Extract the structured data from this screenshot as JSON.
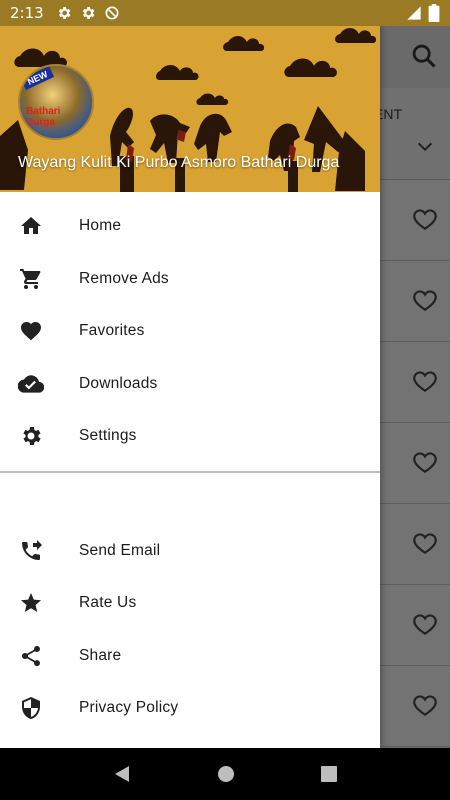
{
  "status_bar": {
    "time": "2:13"
  },
  "background_app": {
    "tab_label": "ENT"
  },
  "drawer": {
    "header_title": "Wayang Kulit Ki Purbo Asmoro Bathari Durga",
    "avatar": {
      "badge": "NEW",
      "caption": "Bathari Durga"
    },
    "primary_items": [
      {
        "label": "Home",
        "icon": "home-icon"
      },
      {
        "label": "Remove Ads",
        "icon": "cart-icon"
      },
      {
        "label": "Favorites",
        "icon": "heart-icon"
      },
      {
        "label": "Downloads",
        "icon": "cloud-done-icon"
      },
      {
        "label": "Settings",
        "icon": "gear-icon"
      }
    ],
    "secondary_items": [
      {
        "label": "Send Email",
        "icon": "phone-forward-icon"
      },
      {
        "label": "Rate Us",
        "icon": "star-icon"
      },
      {
        "label": "Share",
        "icon": "share-icon"
      },
      {
        "label": "Privacy Policy",
        "icon": "shield-icon"
      }
    ]
  },
  "colors": {
    "header_bg": "#d9a333",
    "status_bar": "#9a7a24",
    "drawer_bg": "#ffffff",
    "scrim": "#6b6b6b"
  }
}
